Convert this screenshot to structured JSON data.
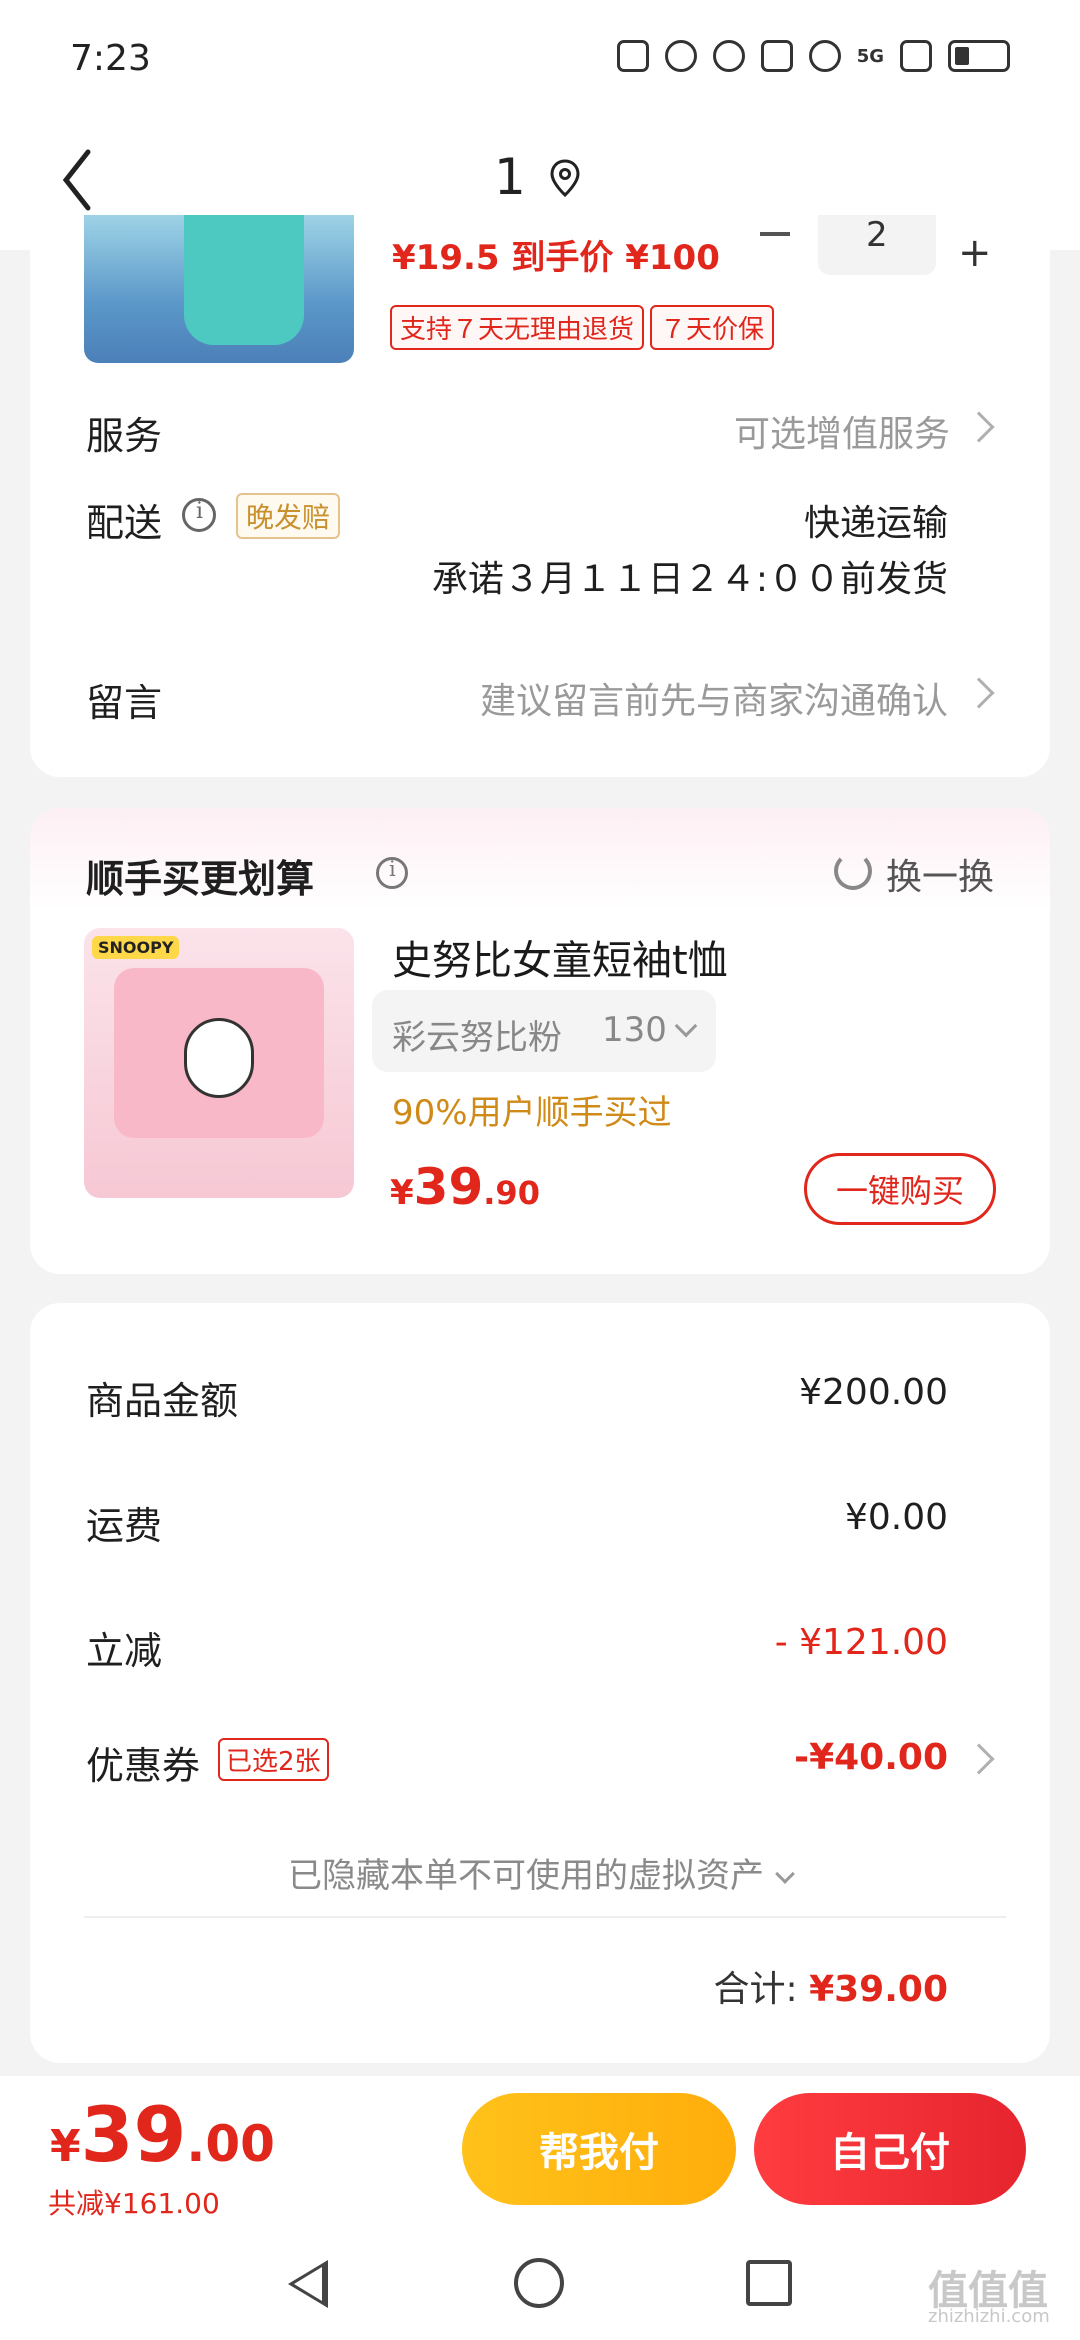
{
  "status_bar": {
    "time": "7:23",
    "network": "5G"
  },
  "header": {
    "title": "1"
  },
  "product": {
    "price_partial": "¥19.5 到手价  ¥100",
    "quantity": "2",
    "tags": [
      "支持７天无理由退货",
      "７天价保"
    ]
  },
  "service": {
    "label": "服务",
    "value": "可选增值服务"
  },
  "delivery": {
    "label": "配送",
    "late_tag": "晚发赔",
    "method": "快递运输",
    "promise": "承诺３月１１日２４:００前发货"
  },
  "message": {
    "label": "留言",
    "placeholder": "建议留言前先与商家沟通确认"
  },
  "addon": {
    "title": "顺手买更划算",
    "refresh": "换一换",
    "product_name": "史努比女童短袖t恤",
    "brand": "SNOOPY",
    "sku_color": "彩云努比粉",
    "sku_size": "130",
    "bought_text": "90%用户顺手买过",
    "price_symbol": "¥",
    "price_int": "39",
    "price_dec": ".90",
    "buy_label": "一键购买"
  },
  "summary": {
    "goods_label": "商品金额",
    "goods_value": "¥200.00",
    "shipping_label": "运费",
    "shipping_value": "¥0.00",
    "discount_label": "立减",
    "discount_value": "- ¥121.00",
    "coupon_label": "优惠券",
    "coupon_tag": "已选2张",
    "coupon_value": "-¥40.00",
    "hidden_assets": "已隐藏本单不可使用的虚拟资产",
    "total_label": "合计:",
    "total_value": "¥39.00"
  },
  "bottom": {
    "price_symbol": "¥",
    "price_int": "39",
    "price_dec": ".00",
    "saved": "共减¥161.00",
    "help_pay": "帮我付",
    "self_pay": "自己付"
  },
  "watermark": {
    "main": "值值值",
    "sub": "zhizhizhi.com"
  }
}
